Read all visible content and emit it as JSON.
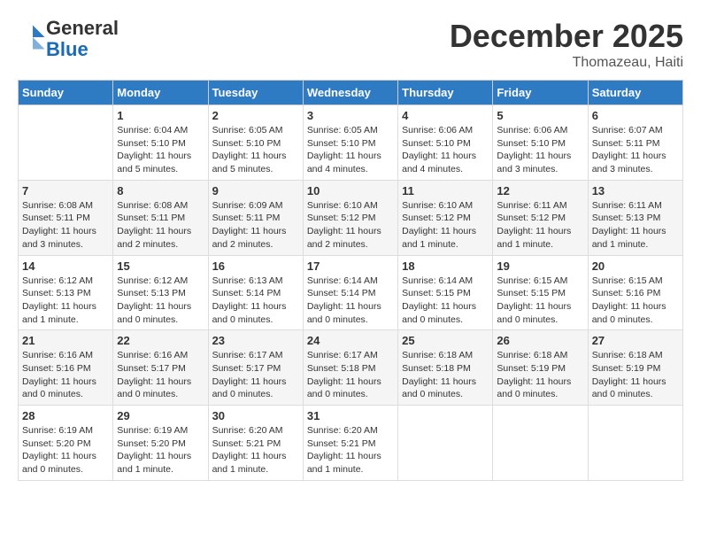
{
  "logo": {
    "general": "General",
    "blue": "Blue"
  },
  "header": {
    "month": "December 2025",
    "location": "Thomazeau, Haiti"
  },
  "days_of_week": [
    "Sunday",
    "Monday",
    "Tuesday",
    "Wednesday",
    "Thursday",
    "Friday",
    "Saturday"
  ],
  "weeks": [
    [
      {
        "day": "",
        "info": ""
      },
      {
        "day": "1",
        "info": "Sunrise: 6:04 AM\nSunset: 5:10 PM\nDaylight: 11 hours\nand 5 minutes."
      },
      {
        "day": "2",
        "info": "Sunrise: 6:05 AM\nSunset: 5:10 PM\nDaylight: 11 hours\nand 5 minutes."
      },
      {
        "day": "3",
        "info": "Sunrise: 6:05 AM\nSunset: 5:10 PM\nDaylight: 11 hours\nand 4 minutes."
      },
      {
        "day": "4",
        "info": "Sunrise: 6:06 AM\nSunset: 5:10 PM\nDaylight: 11 hours\nand 4 minutes."
      },
      {
        "day": "5",
        "info": "Sunrise: 6:06 AM\nSunset: 5:10 PM\nDaylight: 11 hours\nand 3 minutes."
      },
      {
        "day": "6",
        "info": "Sunrise: 6:07 AM\nSunset: 5:11 PM\nDaylight: 11 hours\nand 3 minutes."
      }
    ],
    [
      {
        "day": "7",
        "info": "Sunrise: 6:08 AM\nSunset: 5:11 PM\nDaylight: 11 hours\nand 3 minutes."
      },
      {
        "day": "8",
        "info": "Sunrise: 6:08 AM\nSunset: 5:11 PM\nDaylight: 11 hours\nand 2 minutes."
      },
      {
        "day": "9",
        "info": "Sunrise: 6:09 AM\nSunset: 5:11 PM\nDaylight: 11 hours\nand 2 minutes."
      },
      {
        "day": "10",
        "info": "Sunrise: 6:10 AM\nSunset: 5:12 PM\nDaylight: 11 hours\nand 2 minutes."
      },
      {
        "day": "11",
        "info": "Sunrise: 6:10 AM\nSunset: 5:12 PM\nDaylight: 11 hours\nand 1 minute."
      },
      {
        "day": "12",
        "info": "Sunrise: 6:11 AM\nSunset: 5:12 PM\nDaylight: 11 hours\nand 1 minute."
      },
      {
        "day": "13",
        "info": "Sunrise: 6:11 AM\nSunset: 5:13 PM\nDaylight: 11 hours\nand 1 minute."
      }
    ],
    [
      {
        "day": "14",
        "info": "Sunrise: 6:12 AM\nSunset: 5:13 PM\nDaylight: 11 hours\nand 1 minute."
      },
      {
        "day": "15",
        "info": "Sunrise: 6:12 AM\nSunset: 5:13 PM\nDaylight: 11 hours\nand 0 minutes."
      },
      {
        "day": "16",
        "info": "Sunrise: 6:13 AM\nSunset: 5:14 PM\nDaylight: 11 hours\nand 0 minutes."
      },
      {
        "day": "17",
        "info": "Sunrise: 6:14 AM\nSunset: 5:14 PM\nDaylight: 11 hours\nand 0 minutes."
      },
      {
        "day": "18",
        "info": "Sunrise: 6:14 AM\nSunset: 5:15 PM\nDaylight: 11 hours\nand 0 minutes."
      },
      {
        "day": "19",
        "info": "Sunrise: 6:15 AM\nSunset: 5:15 PM\nDaylight: 11 hours\nand 0 minutes."
      },
      {
        "day": "20",
        "info": "Sunrise: 6:15 AM\nSunset: 5:16 PM\nDaylight: 11 hours\nand 0 minutes."
      }
    ],
    [
      {
        "day": "21",
        "info": "Sunrise: 6:16 AM\nSunset: 5:16 PM\nDaylight: 11 hours\nand 0 minutes."
      },
      {
        "day": "22",
        "info": "Sunrise: 6:16 AM\nSunset: 5:17 PM\nDaylight: 11 hours\nand 0 minutes."
      },
      {
        "day": "23",
        "info": "Sunrise: 6:17 AM\nSunset: 5:17 PM\nDaylight: 11 hours\nand 0 minutes."
      },
      {
        "day": "24",
        "info": "Sunrise: 6:17 AM\nSunset: 5:18 PM\nDaylight: 11 hours\nand 0 minutes."
      },
      {
        "day": "25",
        "info": "Sunrise: 6:18 AM\nSunset: 5:18 PM\nDaylight: 11 hours\nand 0 minutes."
      },
      {
        "day": "26",
        "info": "Sunrise: 6:18 AM\nSunset: 5:19 PM\nDaylight: 11 hours\nand 0 minutes."
      },
      {
        "day": "27",
        "info": "Sunrise: 6:18 AM\nSunset: 5:19 PM\nDaylight: 11 hours\nand 0 minutes."
      }
    ],
    [
      {
        "day": "28",
        "info": "Sunrise: 6:19 AM\nSunset: 5:20 PM\nDaylight: 11 hours\nand 0 minutes."
      },
      {
        "day": "29",
        "info": "Sunrise: 6:19 AM\nSunset: 5:20 PM\nDaylight: 11 hours\nand 1 minute."
      },
      {
        "day": "30",
        "info": "Sunrise: 6:20 AM\nSunset: 5:21 PM\nDaylight: 11 hours\nand 1 minute."
      },
      {
        "day": "31",
        "info": "Sunrise: 6:20 AM\nSunset: 5:21 PM\nDaylight: 11 hours\nand 1 minute."
      },
      {
        "day": "",
        "info": ""
      },
      {
        "day": "",
        "info": ""
      },
      {
        "day": "",
        "info": ""
      }
    ]
  ]
}
